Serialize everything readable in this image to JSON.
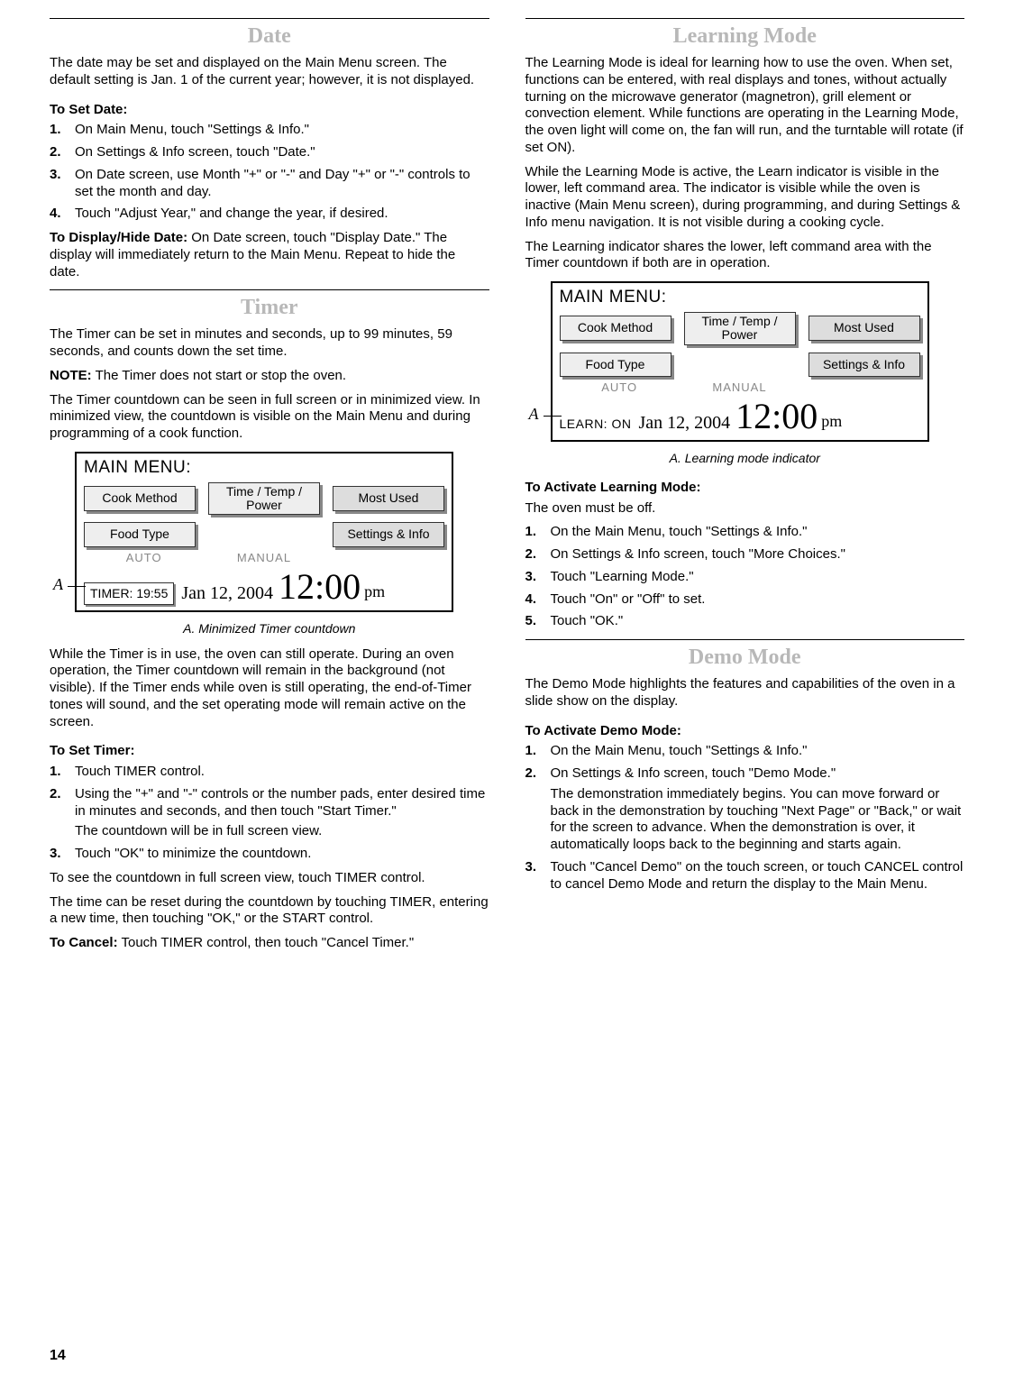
{
  "page_number": "14",
  "left": {
    "date": {
      "title": "Date",
      "p1": "The date may be set and displayed on the Main Menu screen. The default setting is Jan. 1 of the current year; however, it is not displayed.",
      "set_heading": "To Set Date:",
      "steps": [
        "On Main Menu, touch \"Settings & Info.\"",
        "On Settings & Info screen, touch \"Date.\"",
        "On Date screen, use Month \"+\" or \"-\" and Day \"+\" or \"-\" controls to set the month and day.",
        "Touch \"Adjust Year,\" and change the year, if desired."
      ],
      "display_label": "To Display/Hide Date:",
      "display_text": " On Date screen, touch \"Display Date.\" The display will immediately return to the Main Menu. Repeat to hide the date."
    },
    "timer": {
      "title": "Timer",
      "p1": "The Timer can be set in minutes and seconds, up to 99 minutes, 59 seconds, and counts down the set time.",
      "note_label": "NOTE:",
      "note_text": " The Timer does not start or stop the oven.",
      "p2": "The Timer countdown can be seen in full screen or in minimized view. In minimized view, the countdown is visible on the Main Menu and during programming of a cook function.",
      "figure": {
        "a_label": "A",
        "main_menu": "MAIN MENU:",
        "cook_method": "Cook Method",
        "time_temp": "Time / Temp / Power",
        "most_used": "Most Used",
        "food_type": "Food Type",
        "settings_info": "Settings & Info",
        "auto": "AUTO",
        "manual": "MANUAL",
        "status": "TIMER: 19:55",
        "date": "Jan 12, 2004",
        "time": "12:00",
        "ampm": "pm",
        "caption": "A. Minimized Timer countdown"
      },
      "p3": "While the Timer is in use, the oven can still operate. During an oven operation, the Timer countdown will remain in the background (not visible). If the Timer ends while oven is still operating, the end-of-Timer tones will sound, and the set operating mode will remain active on the screen.",
      "set_heading": "To Set Timer:",
      "steps": [
        {
          "text": "Touch TIMER control."
        },
        {
          "text": "Using the \"+\" and \"-\" controls or the number pads, enter desired time in minutes and seconds, and then touch \"Start Timer.\"",
          "sub": "The countdown will be in full screen view."
        },
        {
          "text": "Touch \"OK\" to minimize the countdown."
        }
      ],
      "p4": "To see the countdown in full screen view, touch TIMER control.",
      "p5": "The time can be reset during the countdown by touching TIMER, entering a new time, then touching \"OK,\" or the START control.",
      "cancel_label": "To Cancel:",
      "cancel_text": " Touch TIMER control, then touch \"Cancel Timer.\""
    }
  },
  "right": {
    "learning": {
      "title": "Learning Mode",
      "p1": "The Learning Mode is ideal for learning how to use the oven. When set, functions can be entered, with real displays and tones, without actually turning on the microwave generator (magnetron), grill element or convection element. While functions are operating in the Learning Mode, the oven light will come on, the fan will run, and the turntable will rotate (if set ON).",
      "p2": "While the Learning Mode is active, the Learn indicator is visible in the lower, left command area. The indicator is visible while the oven is inactive (Main Menu screen), during programming, and during Settings & Info menu navigation. It is not visible during a cooking cycle.",
      "p3": "The Learning indicator shares the lower, left command area with the Timer countdown if both are in operation.",
      "figure": {
        "a_label": "A",
        "main_menu": "MAIN MENU:",
        "cook_method": "Cook Method",
        "time_temp": "Time / Temp / Power",
        "most_used": "Most Used",
        "food_type": "Food Type",
        "settings_info": "Settings & Info",
        "auto": "AUTO",
        "manual": "MANUAL",
        "status": "LEARN: ON",
        "date": "Jan 12, 2004",
        "time": "12:00",
        "ampm": "pm",
        "caption": "A. Learning mode indicator"
      },
      "activate_heading": "To Activate Learning Mode:",
      "pre_step": "The oven must be off.",
      "steps": [
        "On the Main Menu, touch \"Settings & Info.\"",
        "On Settings & Info screen, touch \"More Choices.\"",
        "Touch \"Learning Mode.\"",
        "Touch \"On\" or \"Off\" to set.",
        "Touch \"OK.\""
      ]
    },
    "demo": {
      "title": "Demo Mode",
      "p1": "The Demo Mode highlights the features and capabilities of the oven in a slide show on the display.",
      "activate_heading": "To Activate Demo Mode:",
      "steps": [
        {
          "text": "On the Main Menu, touch \"Settings & Info.\""
        },
        {
          "text": "On Settings & Info screen, touch \"Demo Mode.\"",
          "sub": "The demonstration immediately begins. You can move forward or back in the demonstration by touching \"Next Page\" or \"Back,\" or wait for the screen to advance. When the demonstration is over, it automatically loops back to the beginning and starts again."
        },
        {
          "text": "Touch \"Cancel Demo\" on the touch screen, or touch CANCEL control to cancel Demo Mode and return the display to the Main Menu."
        }
      ]
    }
  }
}
